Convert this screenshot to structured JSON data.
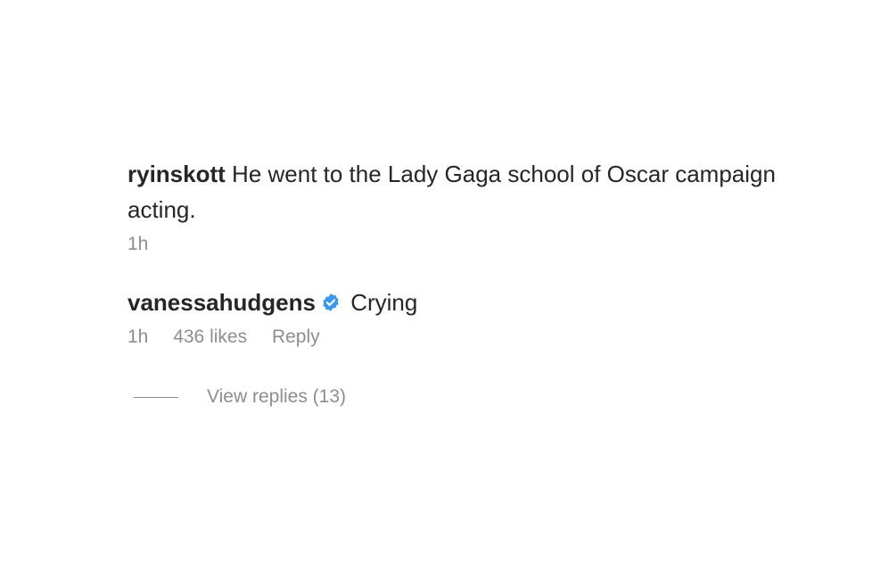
{
  "comments": [
    {
      "username": "ryinskott",
      "text": "He went to the Lady Gaga school of Oscar campaign acting.",
      "time": "1h"
    },
    {
      "username": "vanessahudgens",
      "verified": true,
      "text": "Crying",
      "time": "1h",
      "likes": "436 likes",
      "reply_label": "Reply"
    }
  ],
  "view_replies_label": "View replies (13)",
  "colors": {
    "text": "#262626",
    "muted": "#8e8e8e",
    "verified_badge": "#3897f0"
  },
  "icons": {
    "verified": "verified-badge-icon"
  }
}
